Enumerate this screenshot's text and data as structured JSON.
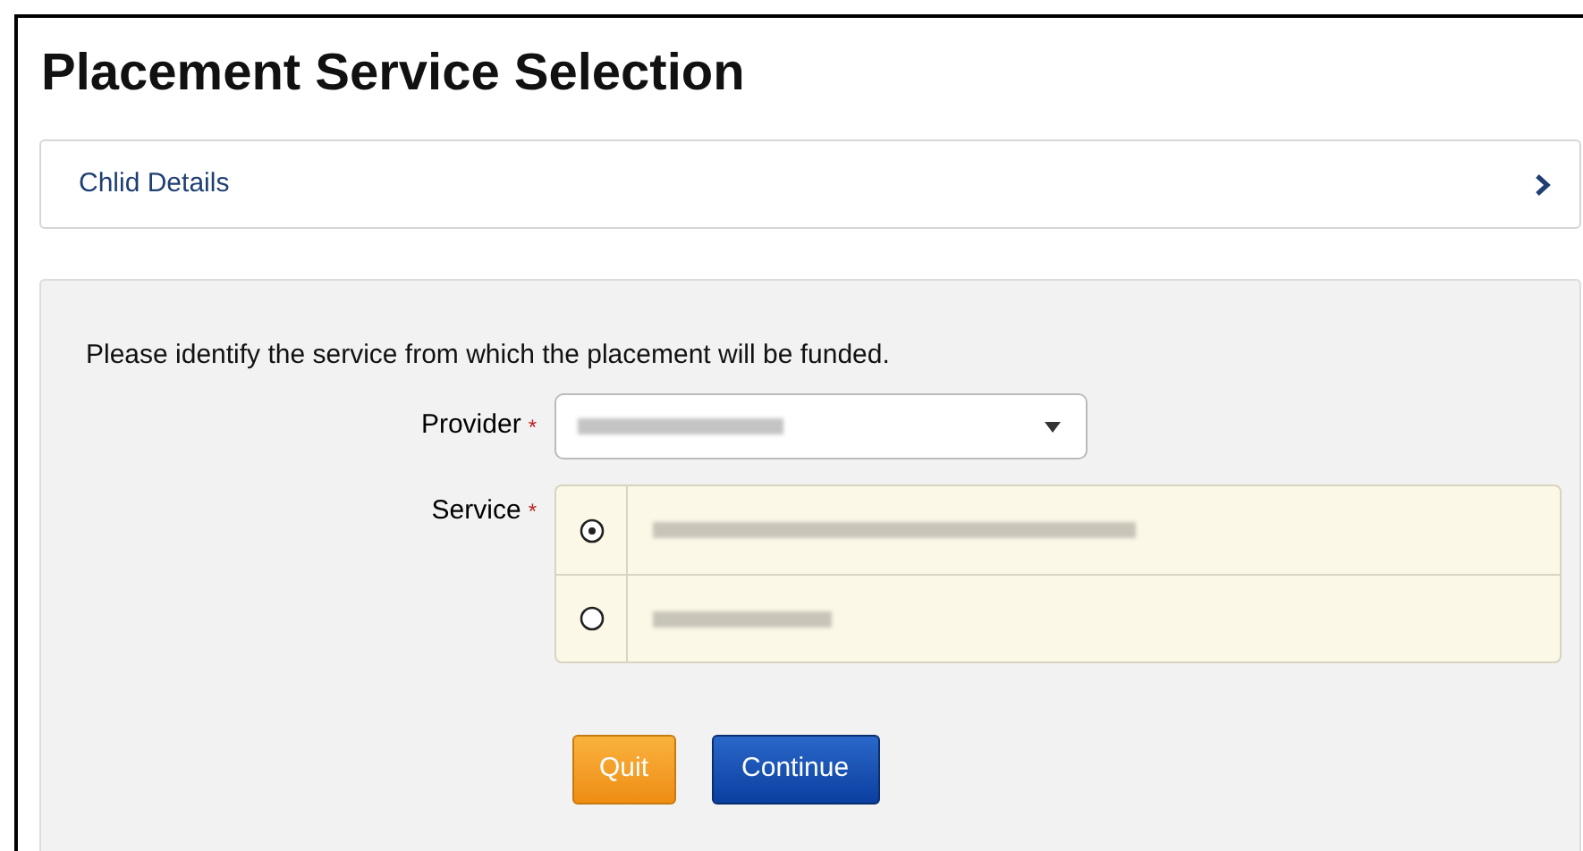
{
  "title": "Placement Service Selection",
  "section": {
    "label": "Chlid Details",
    "expanded": false
  },
  "instruction": "Please identify the service from which the placement will be funded.",
  "provider": {
    "label": "Provider",
    "required_mark": "*"
  },
  "service": {
    "label": "Service",
    "required_mark": "*",
    "options": [
      {
        "selected": true
      },
      {
        "selected": false
      }
    ]
  },
  "buttons": [
    {
      "label": "Quit",
      "kind": "secondary"
    },
    {
      "label": "Continue",
      "kind": "primary"
    }
  ]
}
